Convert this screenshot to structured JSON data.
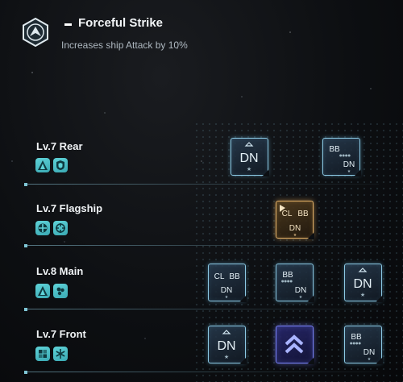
{
  "header": {
    "icon": "fleet-arrow-icon",
    "title": "Forceful Strike",
    "description": "Increases ship Attack by 10%"
  },
  "rows": [
    {
      "label": "Lv.7 Rear",
      "badges": [
        "mountain-icon",
        "shield-icon"
      ],
      "cards": [
        {
          "type": "dn",
          "text": "DN"
        },
        {
          "type": "bb-dn",
          "text_top": "BB",
          "text_bottom": "DN"
        }
      ]
    },
    {
      "label": "Lv.7 Flagship",
      "badges": [
        "target-cross-icon",
        "crosshair-icon"
      ],
      "cards": [
        {
          "type": "cl-bb-dn",
          "text_a": "CL",
          "text_b": "BB",
          "text_c": "DN",
          "highlight": "gold"
        }
      ]
    },
    {
      "label": "Lv.8 Main",
      "badges": [
        "mountain-icon",
        "cluster-icon"
      ],
      "cards": [
        {
          "type": "cl-bb-dn",
          "text_a": "CL",
          "text_b": "BB",
          "text_c": "DN"
        },
        {
          "type": "bb-dn",
          "text_top": "BB",
          "text_bottom": "DN"
        },
        {
          "type": "dn",
          "text": "DN"
        }
      ]
    },
    {
      "label": "Lv.7 Front",
      "badges": [
        "puzzle-icon",
        "snowflake-icon"
      ],
      "cards": [
        {
          "type": "dn",
          "text": "DN"
        },
        {
          "type": "chevron",
          "icon": "double-chevron-up-icon",
          "highlight": "purple"
        },
        {
          "type": "bb-dn",
          "text_top": "BB",
          "text_bottom": "DN"
        }
      ]
    }
  ],
  "colors": {
    "accent": "#5fd3d8",
    "card_border": "#8cc9e4",
    "gold": "#e6b46a",
    "purple": "#7c86ff"
  }
}
